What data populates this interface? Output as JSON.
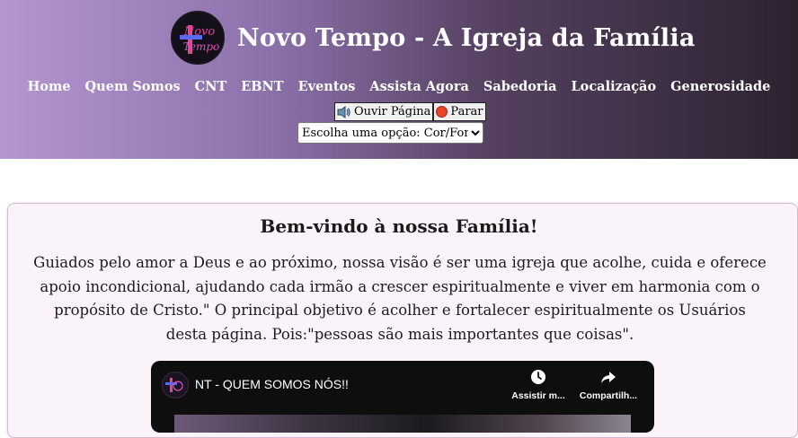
{
  "header": {
    "title": "Novo Tempo - A Igreja da Família",
    "logo_text": [
      "Novo",
      "Tempo"
    ]
  },
  "nav": {
    "items": [
      {
        "label": "Home",
        "name": "nav-home"
      },
      {
        "label": "Quem Somos",
        "name": "nav-quem-somos"
      },
      {
        "label": "CNT",
        "name": "nav-cnt"
      },
      {
        "label": "EBNT",
        "name": "nav-ebnt"
      },
      {
        "label": "Eventos",
        "name": "nav-eventos"
      },
      {
        "label": "Assista Agora",
        "name": "nav-assista-agora"
      },
      {
        "label": "Sabedoria",
        "name": "nav-sabedoria"
      },
      {
        "label": "Localização",
        "name": "nav-localizacao"
      },
      {
        "label": "Generosidade",
        "name": "nav-generosidade"
      }
    ]
  },
  "tts": {
    "listen_label": "Ouvir Página",
    "stop_label": "Parar",
    "listen_icon": "speaker-icon",
    "stop_icon": "stop-icon"
  },
  "theme_select": {
    "selected": "Escolha uma opção: Cor/Fonte:"
  },
  "welcome": {
    "heading": "Bem-vindo à nossa Família!",
    "intro": "Guiados pelo amor a Deus e ao próximo, nossa visão é ser uma igreja que acolhe, cuida e oferece apoio incondicional, ajudando cada irmão a crescer espiritualmente e viver em harmonia com o propósito de Cristo.\" O principal objetivo é acolher e fortalecer espiritualmente os Usuários desta página. Pois:\"pessoas são mais importantes que coisas\"."
  },
  "video": {
    "title": "NT - QUEM SOMOS NÓS!!",
    "watch_later_label": "Assistir m...",
    "share_label": "Compartilh...",
    "watch_later_icon": "clock-icon",
    "share_icon": "share-icon"
  },
  "colors": {
    "header_gradient_start": "#b497d0",
    "header_gradient_end": "#2c2230",
    "logo_pink": "#e0459a",
    "logo_blue": "#5a6bf0",
    "card_bg": "#fbf3fa",
    "card_border": "#d6b8d3",
    "video_bg": "#0e0e0e"
  }
}
